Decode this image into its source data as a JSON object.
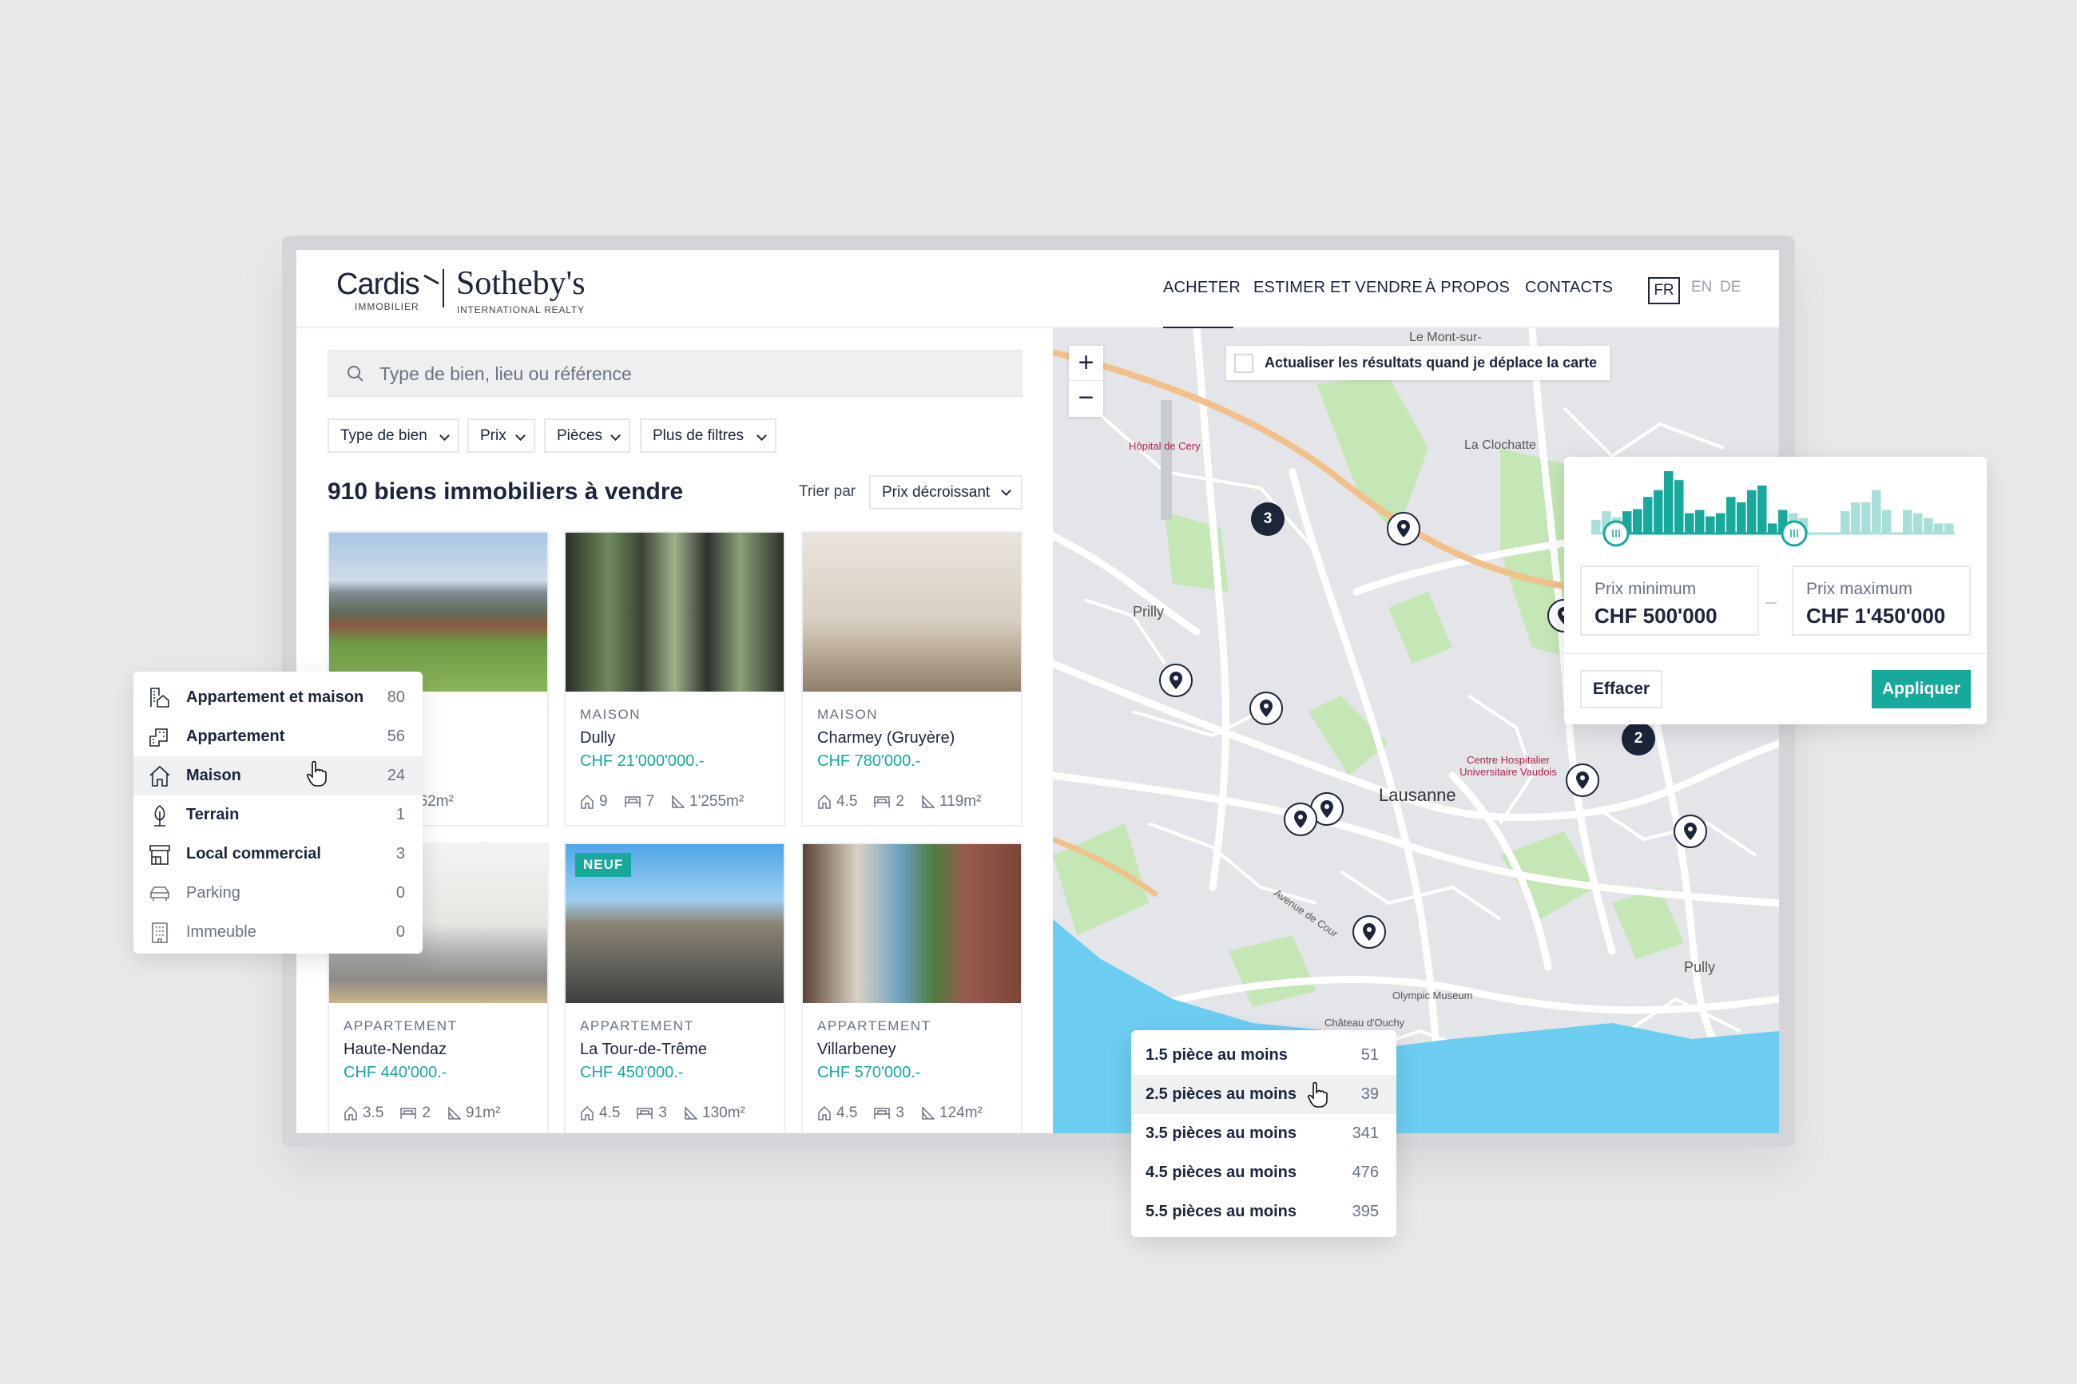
{
  "header": {
    "logo_primary": "Cardis",
    "logo_primary_sub": "IMMOBILIER",
    "logo_secondary": "Sotheby's",
    "logo_secondary_sub": "INTERNATIONAL REALTY",
    "nav": [
      "ACHETER",
      "ESTIMER ET VENDRE",
      "À PROPOS",
      "CONTACTS"
    ],
    "active_nav": "ACHETER",
    "languages": [
      "FR",
      "EN",
      "DE"
    ],
    "active_language": "FR"
  },
  "search": {
    "placeholder": "Type de bien, lieu ou référence",
    "icon": "search-icon"
  },
  "filters": [
    "Type de bien",
    "Prix",
    "Pièces",
    "Plus de filtres"
  ],
  "results": {
    "title": "910 biens immobiliers à vendre",
    "sort_label": "Trier par",
    "sort_value": "Prix décroissant"
  },
  "cards": [
    {
      "type": "",
      "name": "",
      "price": "",
      "rooms": "",
      "bedrooms": "",
      "area": "162m²",
      "badge": ""
    },
    {
      "type": "MAISON",
      "name": "Dully",
      "price": "CHF 21'000'000.-",
      "rooms": "9",
      "bedrooms": "7",
      "area": "1'255m²",
      "badge": ""
    },
    {
      "type": "MAISON",
      "name": "Charmey (Gruyère)",
      "price": "CHF 780'000.-",
      "rooms": "4.5",
      "bedrooms": "2",
      "area": "119m²",
      "badge": ""
    },
    {
      "type": "APPARTEMENT",
      "name": "Haute-Nendaz",
      "price": "CHF 440'000.-",
      "rooms": "3.5",
      "bedrooms": "2",
      "area": "91m²",
      "badge": ""
    },
    {
      "type": "APPARTEMENT",
      "name": "La Tour-de-Trême",
      "price": "CHF 450'000.-",
      "rooms": "4.5",
      "bedrooms": "3",
      "area": "130m²",
      "badge": "NEUF"
    },
    {
      "type": "APPARTEMENT",
      "name": "Villarbeney",
      "price": "CHF 570'000.-",
      "rooms": "4.5",
      "bedrooms": "3",
      "area": "124m²",
      "badge": ""
    }
  ],
  "type_dropdown": [
    {
      "label": "Appartement et maison",
      "count": "80",
      "icon": "building-house-icon"
    },
    {
      "label": "Appartement",
      "count": "56",
      "icon": "apartment-icon"
    },
    {
      "label": "Maison",
      "count": "24",
      "icon": "house-icon",
      "hovered": true
    },
    {
      "label": "Terrain",
      "count": "1",
      "icon": "tree-icon"
    },
    {
      "label": "Local commercial",
      "count": "3",
      "icon": "store-icon"
    },
    {
      "label": "Parking",
      "count": "0",
      "icon": "car-icon",
      "disabled": true
    },
    {
      "label": "Immeuble",
      "count": "0",
      "icon": "office-building-icon",
      "disabled": true
    }
  ],
  "price_filter": {
    "min_label": "Prix minimum",
    "min_value": "CHF 500'000",
    "max_label": "Prix maximum",
    "max_value": "CHF 1'450'000",
    "clear_label": "Effacer",
    "apply_label": "Appliquer",
    "histogram": [
      50,
      82,
      60,
      82,
      90,
      135,
      160,
      230,
      197,
      75,
      87,
      63,
      75,
      135,
      115,
      160,
      177,
      37,
      87,
      75,
      57,
      0,
      0,
      0,
      82,
      115,
      115,
      160,
      87,
      0,
      87,
      75,
      57,
      37,
      37
    ],
    "selected_bins": [
      3,
      18
    ],
    "accent": "#17a99b",
    "inactive": "#a9dfd9"
  },
  "rooms_dropdown": [
    {
      "label": "1.5 pièce au moins",
      "count": "51"
    },
    {
      "label": "2.5 pièces au moins",
      "count": "39",
      "hovered": true
    },
    {
      "label": "3.5 pièces au moins",
      "count": "341"
    },
    {
      "label": "4.5 pièces au moins",
      "count": "476"
    },
    {
      "label": "5.5 pièces au moins",
      "count": "395"
    }
  ],
  "map": {
    "refresh_label": "Actualiser les résultats quand je déplace la carte",
    "refresh_checked": false,
    "zoom_in": "+",
    "zoom_out": "−",
    "labels": [
      "Le Mont-sur-",
      "La Clochatte",
      "Hôpital de Cery",
      "Prilly",
      "Lausanne",
      "Centre Hospitalier Universitaire Vaudois",
      "Avenue de Cour",
      "Olympic Museum",
      "Château d'Ouchy",
      "Pully"
    ],
    "clusters": [
      "3",
      "2"
    ],
    "colors": {
      "land": "#e4e5e8",
      "water": "#6ccdf0",
      "park": "#bfe3b0",
      "highway": "#f2c08a",
      "marker": "#1c2539"
    }
  },
  "colors": {
    "accent": "#17a99b",
    "text": "#1c2539"
  }
}
